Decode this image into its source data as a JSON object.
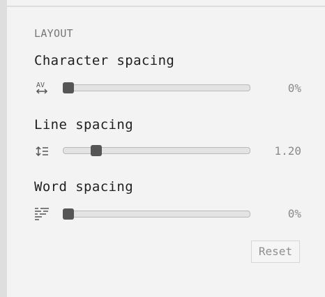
{
  "section": {
    "title": "LAYOUT"
  },
  "settings": [
    {
      "label": "Character spacing",
      "icon": "character-spacing-icon",
      "value_text": "0%",
      "level": 0.0
    },
    {
      "label": "Line spacing",
      "icon": "line-spacing-icon",
      "value_text": "1.20",
      "level": 0.16
    },
    {
      "label": "Word spacing",
      "icon": "word-spacing-icon",
      "value_text": "0%",
      "level": 0.0
    }
  ],
  "actions": {
    "reset_label": "Reset"
  },
  "colors": {
    "background": "#f3f3f3",
    "track": "#e3e3e3",
    "thumb": "#555555",
    "muted_text": "#8a8a8a"
  }
}
